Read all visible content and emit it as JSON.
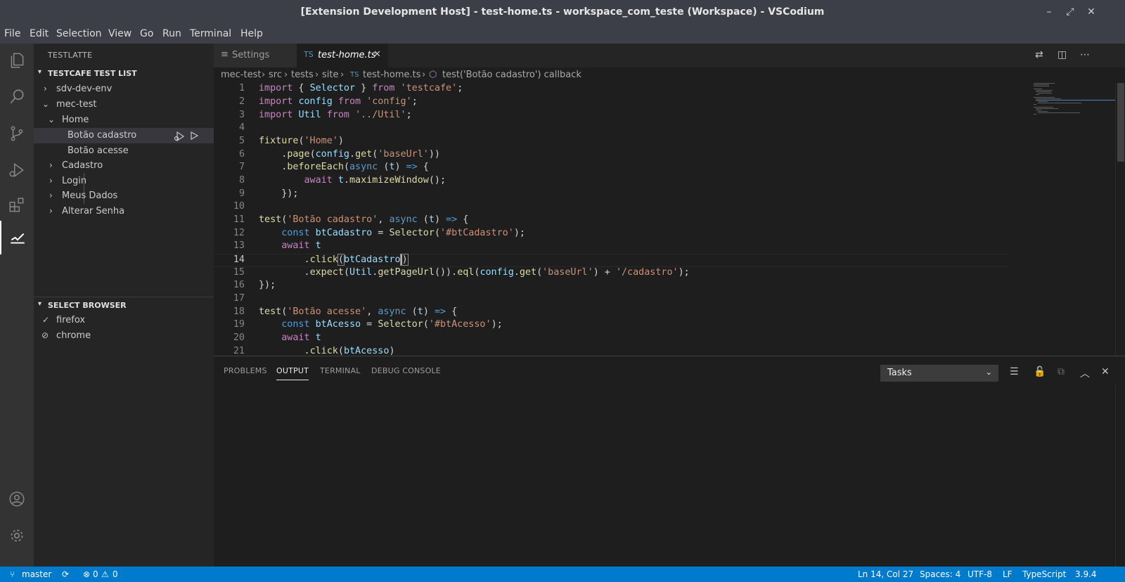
{
  "window": {
    "title": "[Extension Development Host] - test-home.ts - workspace_com_teste (Workspace) - VSCodium",
    "minimize_icon": "minimize-icon",
    "restore_icon": "restore-icon",
    "close_icon": "close-icon"
  },
  "menu": [
    "File",
    "Edit",
    "Selection",
    "View",
    "Go",
    "Run",
    "Terminal",
    "Help"
  ],
  "activity_bar": {
    "items": [
      "files-icon",
      "search-icon",
      "source-control-icon",
      "run-debug-icon",
      "extensions-icon",
      "testlatte-icon"
    ],
    "bottom": [
      "account-icon",
      "settings-gear-icon"
    ],
    "active": "testlatte-icon"
  },
  "sidebar": {
    "title": "TESTLATTE",
    "test_list": {
      "header": "TESTCAFE TEST LIST",
      "items": [
        {
          "label": "sdv-dev-env",
          "chevron": ">"
        },
        {
          "label": "mec-test",
          "chevron": "v"
        },
        {
          "label": "Home",
          "chevron": "v"
        },
        {
          "label": "Botão cadastro",
          "selected": true
        },
        {
          "label": "Botão acesse"
        },
        {
          "label": "Cadastro",
          "chevron": ">"
        },
        {
          "label": "Login",
          "chevron": ">"
        },
        {
          "label": "Meus Dados",
          "chevron": ">"
        },
        {
          "label": "Alterar Senha",
          "chevron": ">"
        }
      ]
    },
    "browser_section": {
      "header": "SELECT BROWSER",
      "items": [
        {
          "label": "firefox",
          "icon": "check-icon",
          "glyph": "✓"
        },
        {
          "label": "chrome",
          "icon": "disabled-icon",
          "glyph": "⊘"
        }
      ]
    }
  },
  "tabs": [
    {
      "label": "Settings",
      "icon": "≡",
      "active": false
    },
    {
      "label": "test-home.ts",
      "icon": "TS",
      "active": true,
      "close": "✕"
    }
  ],
  "editor_actions": [
    "open-changes-icon",
    "split-editor-icon",
    "more-actions-icon"
  ],
  "breadcrumb": [
    "mec-test",
    "src",
    "tests",
    "site",
    "test-home.ts",
    "test('Botão cadastro') callback"
  ],
  "editor": {
    "current_line": 14,
    "lines": [
      {
        "n": "1",
        "text": "import { Selector } from 'testcafe';"
      },
      {
        "n": "2",
        "text": "import config from 'config';"
      },
      {
        "n": "3",
        "text": "import Util from '../Util';"
      },
      {
        "n": "4",
        "text": ""
      },
      {
        "n": "5",
        "text": "fixture('Home')"
      },
      {
        "n": "6",
        "text": "    .page(config.get('baseUrl'))"
      },
      {
        "n": "7",
        "text": "    .beforeEach(async (t) => {"
      },
      {
        "n": "8",
        "text": "        await t.maximizeWindow();"
      },
      {
        "n": "9",
        "text": "    });"
      },
      {
        "n": "10",
        "text": ""
      },
      {
        "n": "11",
        "text": "test('Botão cadastro', async (t) => {"
      },
      {
        "n": "12",
        "text": "    const btCadastro = Selector('#btCadastro');"
      },
      {
        "n": "13",
        "text": "    await t"
      },
      {
        "n": "14",
        "text": "        .click(btCadastro)"
      },
      {
        "n": "15",
        "text": "        .expect(Util.getPageUrl()).eql(config.get('baseUrl') + '/cadastro');"
      },
      {
        "n": "16",
        "text": "});"
      },
      {
        "n": "17",
        "text": ""
      },
      {
        "n": "18",
        "text": "test('Botão acesse', async (t) => {"
      },
      {
        "n": "19",
        "text": "    const btAcesso = Selector('#btAcesso');"
      },
      {
        "n": "20",
        "text": "    await t"
      },
      {
        "n": "21",
        "text": "        .click(btAcesso)"
      }
    ]
  },
  "panel": {
    "tabs": [
      "PROBLEMS",
      "OUTPUT",
      "TERMINAL",
      "DEBUG CONSOLE"
    ],
    "active_tab": "OUTPUT",
    "output_channel": "Tasks",
    "actions": [
      "clear-output-icon",
      "lock-scroll-icon",
      "open-log-icon",
      "maximize-panel-icon",
      "close-panel-icon"
    ]
  },
  "status_bar": {
    "branch": "master",
    "errors": "0",
    "warnings": "0",
    "position": "Ln 14, Col 27",
    "indent": "Spaces: 4",
    "encoding": "UTF-8",
    "eol": "LF",
    "language": "TypeScript",
    "version": "3.9.4"
  },
  "colors": {
    "titlebar": "#3c3f47",
    "statusbar": "#007acc",
    "editor_bg": "#1e1e1e",
    "sidebar_bg": "#252526",
    "activitybar_bg": "#333333"
  }
}
